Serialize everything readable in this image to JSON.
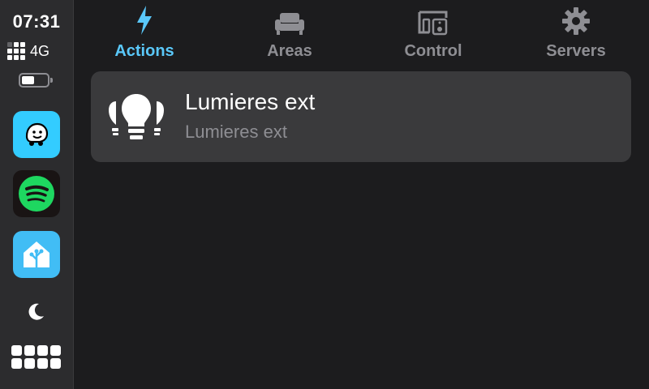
{
  "status": {
    "time": "07:31",
    "network": "4G",
    "battery_level": 0.5
  },
  "dock": {
    "apps": [
      {
        "name": "Waze",
        "icon": "waze-icon",
        "color": "#33ccff"
      },
      {
        "name": "Spotify",
        "icon": "spotify-icon",
        "color": "#1ed760"
      },
      {
        "name": "Home Assistant",
        "icon": "home-assistant-icon",
        "color": "#41bdf5"
      }
    ],
    "moon_icon": "moon-icon",
    "grid_icon": "app-grid-icon"
  },
  "tabs": [
    {
      "label": "Actions",
      "icon": "lightning-icon",
      "active": true
    },
    {
      "label": "Areas",
      "icon": "sofa-icon",
      "active": false
    },
    {
      "label": "Control",
      "icon": "devices-icon",
      "active": false
    },
    {
      "label": "Servers",
      "icon": "gear-icon",
      "active": false
    }
  ],
  "actions": [
    {
      "title": "Lumieres ext",
      "subtitle": "Lumieres ext",
      "icon": "lightbulb-group-icon"
    }
  ],
  "colors": {
    "accent": "#5ac8fa",
    "inactive": "#8e8e93",
    "card": "#3a3a3c",
    "background": "#1c1c1e"
  }
}
